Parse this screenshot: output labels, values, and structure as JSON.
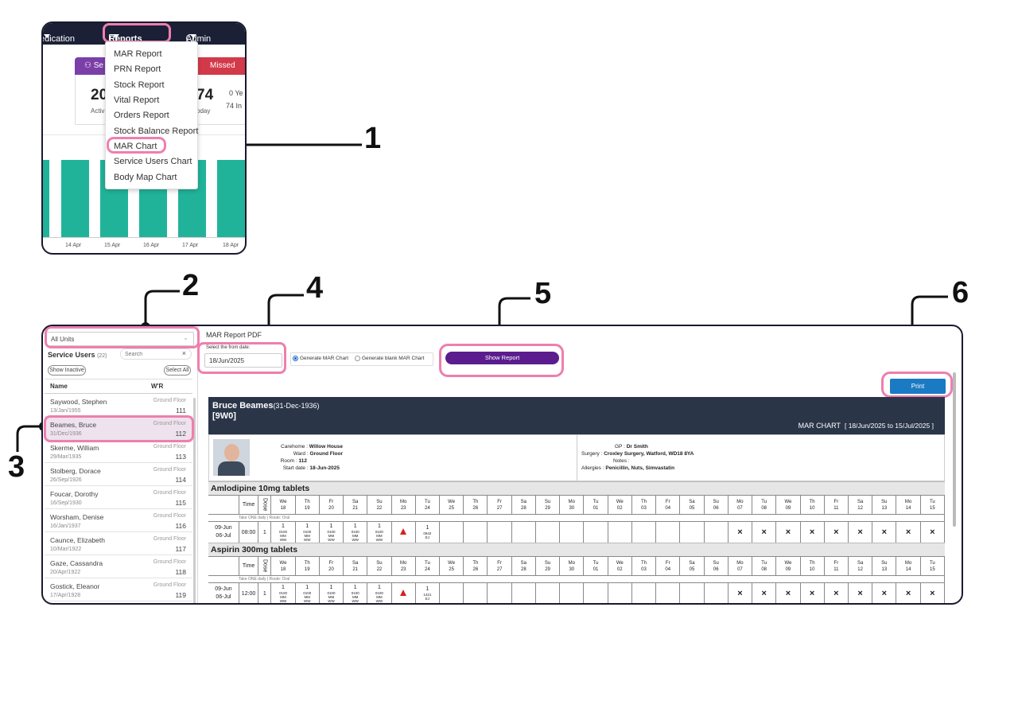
{
  "callouts": [
    "1",
    "2",
    "3",
    "4",
    "5",
    "6"
  ],
  "nav": {
    "items": [
      "edication",
      "Reports",
      "Admin"
    ]
  },
  "dashboard": {
    "card1_label": "Se",
    "card2_label": "Missed",
    "big1": "20",
    "sub1": "Activ",
    "big2": "74",
    "sub2": "oday",
    "small_rows": [
      "0 Ye",
      "74 In"
    ],
    "dates": [
      "14 Apr",
      "15 Apr",
      "16 Apr",
      "17 Apr",
      "18 Apr"
    ]
  },
  "reports_menu": [
    "MAR Report",
    "PRN Report",
    "Stock Report",
    "Vital Report",
    "Orders Report",
    "Stock Balance Report",
    "MAR Chart",
    "Service Users Chart",
    "Body Map Chart"
  ],
  "left": {
    "units_select": "All Units",
    "title": "Service Users",
    "count": "(22)",
    "search_placeholder": "Search",
    "show_inactive": "Show Inactive",
    "select_all": "Select All",
    "col_name": "Name",
    "col_wr": "W'R",
    "users": [
      {
        "name": "Saywood, Stephen",
        "dob": "13/Jan/1955",
        "floor": "Ground Floor",
        "room": "111"
      },
      {
        "name": "Beames, Bruce",
        "dob": "31/Dec/1936",
        "floor": "Ground Floor",
        "room": "112"
      },
      {
        "name": "Skerme, William",
        "dob": "29/Mar/1935",
        "floor": "Ground Floor",
        "room": "113"
      },
      {
        "name": "Stolberg, Dorace",
        "dob": "26/Sep/1926",
        "floor": "Ground Floor",
        "room": "114"
      },
      {
        "name": "Foucar, Dorothy",
        "dob": "16/Sep/1930",
        "floor": "Ground Floor",
        "room": "115"
      },
      {
        "name": "Worsham, Denise",
        "dob": "16/Jan/1937",
        "floor": "Ground Floor",
        "room": "116"
      },
      {
        "name": "Caunce, Elizabeth",
        "dob": "10/Mar/1922",
        "floor": "Ground Floor",
        "room": "117"
      },
      {
        "name": "Gaze, Cassandra",
        "dob": "20/Apr/1922",
        "floor": "Ground Floor",
        "room": "118"
      },
      {
        "name": "Gostick, Eleanor",
        "dob": "17/Apr/1928",
        "floor": "Ground Floor",
        "room": "119"
      }
    ]
  },
  "report": {
    "title": "MAR Report PDF",
    "from_label": "Select the from date:",
    "from_date": "18/Jun/2025",
    "radio1": "Generate MAR Chart",
    "radio2": "Generate blank MAR Chart",
    "show_btn": "Show Report",
    "print_btn": "Print"
  },
  "chart": {
    "patient": "Bruce Beames",
    "dob": "(31-Dec-1936)",
    "code": "[9W0]",
    "label": "MAR CHART",
    "range": "[ 18/Jun/2025  to 15/Jul/2025 ]",
    "info_left": [
      {
        "k": "Carehome : ",
        "v": "Willow House"
      },
      {
        "k": "Ward : ",
        "v": "Ground Floor"
      },
      {
        "k": "Room : ",
        "v": "112"
      },
      {
        "k": "Start date : ",
        "v": "18-Jun-2025"
      }
    ],
    "info_right": [
      {
        "k": "GP : ",
        "v": "Dr Smith"
      },
      {
        "k": "Surgery : ",
        "v": "Croxley Surgery, Watford, WD18 8YA"
      },
      {
        "k": "Notes : ",
        "v": ""
      },
      {
        "k": "Allergies : ",
        "v": "Penicillin, Nuts, Simvastatin"
      }
    ],
    "col_time": "Time",
    "col_dose": "Dose",
    "days": [
      [
        "We",
        "18"
      ],
      [
        "Th",
        "19"
      ],
      [
        "Fr",
        "20"
      ],
      [
        "Sa",
        "21"
      ],
      [
        "Su",
        "22"
      ],
      [
        "Mo",
        "23"
      ],
      [
        "Tu",
        "24"
      ],
      [
        "We",
        "25"
      ],
      [
        "Th",
        "26"
      ],
      [
        "Fr",
        "27"
      ],
      [
        "Sa",
        "28"
      ],
      [
        "Su",
        "29"
      ],
      [
        "Mo",
        "30"
      ],
      [
        "Tu",
        "01"
      ],
      [
        "We",
        "02"
      ],
      [
        "Th",
        "03"
      ],
      [
        "Fr",
        "04"
      ],
      [
        "Sa",
        "05"
      ],
      [
        "Su",
        "06"
      ],
      [
        "Mo",
        "07"
      ],
      [
        "Tu",
        "08"
      ],
      [
        "We",
        "09"
      ],
      [
        "Th",
        "10"
      ],
      [
        "Fr",
        "11"
      ],
      [
        "Sa",
        "12"
      ],
      [
        "Su",
        "13"
      ],
      [
        "Mo",
        "14"
      ],
      [
        "Tu",
        "15"
      ]
    ],
    "meds": [
      {
        "name": "Amlodipine 10mg tablets",
        "instr": "Take ONE daily | Route: Oral",
        "from": "09-Jun",
        "to": "06-Jul",
        "time": "08:00",
        "dose": "1",
        "sig_last": "0942"
      },
      {
        "name": "Aspirin 300mg tablets",
        "instr": "Take ONE daily | Route: Oral",
        "from": "09-Jun",
        "to": "06-Jul",
        "time": "12:00",
        "dose": "1",
        "sig_last": "1421"
      }
    ],
    "sig": {
      "one": "1",
      "t": "0100",
      "a": "MM",
      "b": "WW",
      "c": "EJ"
    },
    "cross": "×"
  },
  "colors": {
    "nav": "#1b2036",
    "highlight": "#ee7fae",
    "purple": "#5b1d8e",
    "blue": "#1b7ac4",
    "header": "#2a3548"
  }
}
